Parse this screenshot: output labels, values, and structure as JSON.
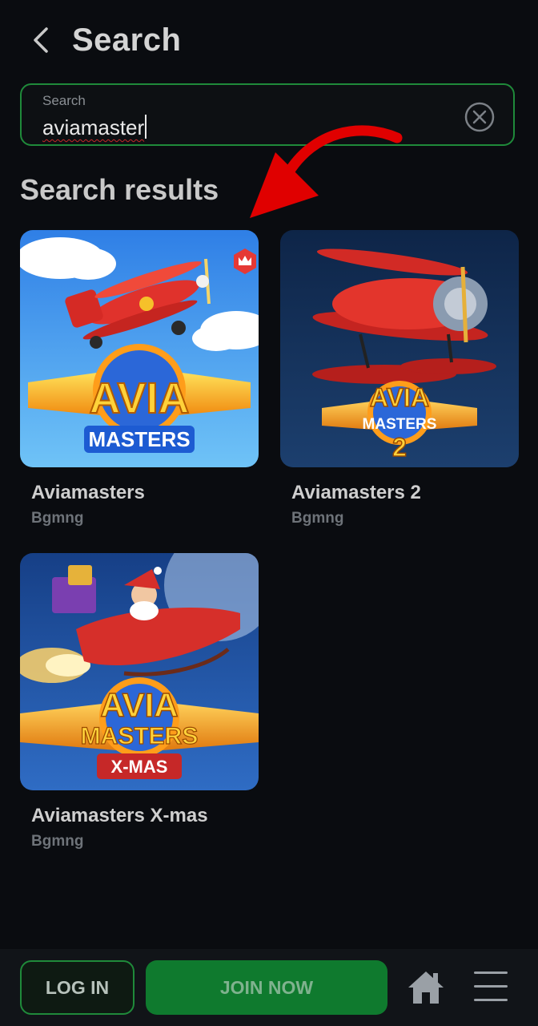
{
  "header": {
    "title": "Search"
  },
  "search": {
    "label": "Search",
    "value": "aviamaster"
  },
  "results": {
    "heading": "Search results",
    "items": [
      {
        "title": "Aviamasters",
        "provider": "Bgmng",
        "logo_line1": "AVIA",
        "logo_line2": "MASTERS"
      },
      {
        "title": "Aviamasters 2",
        "provider": "Bgmng",
        "logo_line1": "AVIA",
        "logo_line2": "MASTERS",
        "logo_line3": "2"
      },
      {
        "title": "Aviamasters X-mas",
        "provider": "Bgmng",
        "logo_line1": "AVIA",
        "logo_line2": "MASTERS",
        "logo_line3": "X-MAS"
      }
    ]
  },
  "bottom_bar": {
    "login_label": "LOG IN",
    "join_label": "JOIN NOW"
  },
  "colors": {
    "background": "#0a0c10",
    "accent_green": "#1f8a3a",
    "join_green": "#0f7a2e",
    "annotation_red": "#e00000"
  },
  "icons": [
    "back-chevron-icon",
    "clear-circle-icon",
    "crown-icon",
    "home-icon",
    "hamburger-menu-icon",
    "red-arrow-annotation"
  ]
}
